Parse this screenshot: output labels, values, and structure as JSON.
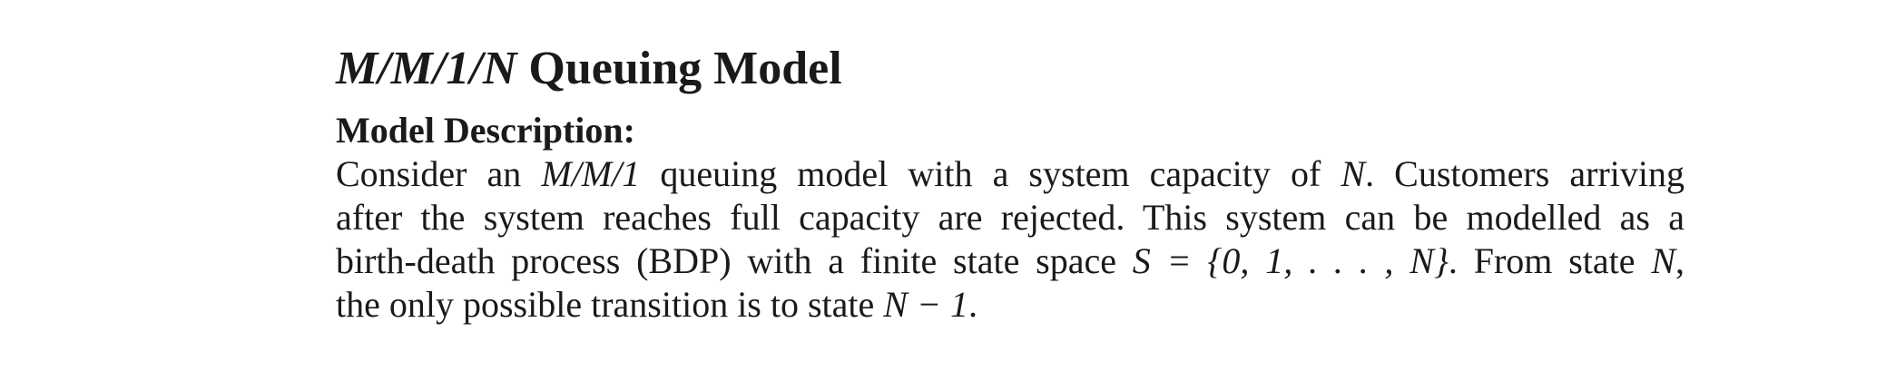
{
  "document": {
    "title_math": "M/M/1/N",
    "title_text": "Queuing Model",
    "section_heading": "Model Description:",
    "paragraph_lines": [
      "Consider an M/M/1 queuing model with a system capacity of N. Customers arriving",
      "after the system reaches full capacity are rejected. This system can be modelled as a",
      "birth-death process (BDP) with a finite state space S = {0, 1, . . . , N}. From state N,",
      "the only possible transition is to state N − 1."
    ]
  }
}
